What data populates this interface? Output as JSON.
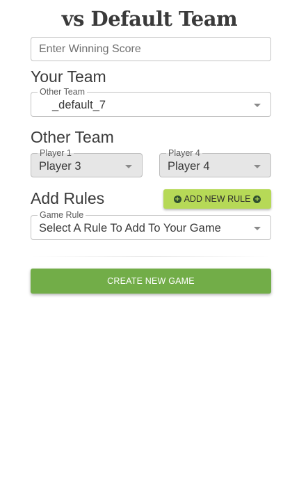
{
  "header": {
    "title": "vs Default Team"
  },
  "winning_score": {
    "placeholder": "Enter Winning Score",
    "value": ""
  },
  "your_team": {
    "heading": "Your Team",
    "select": {
      "label": "Other Team",
      "value": "_default_7"
    }
  },
  "other_team": {
    "heading": "Other Team",
    "player_a": {
      "label": "Player 1",
      "value": "Player 3"
    },
    "player_b": {
      "label": "Player 4",
      "value": "Player 4"
    }
  },
  "rules": {
    "heading": "Add Rules",
    "add_button_label": "ADD NEW RULE",
    "select": {
      "label": "Game Rule",
      "value": "Select A Rule To Add To Your Game"
    }
  },
  "actions": {
    "create_label": "CREATE NEW GAME"
  },
  "icons": {
    "plus": "plus-circle-icon",
    "caret": "caret-down-icon"
  },
  "colors": {
    "add_rule_button": "#b6d957",
    "create_button": "#72ad48",
    "select_disabled_bg": "#e6e6e6"
  }
}
